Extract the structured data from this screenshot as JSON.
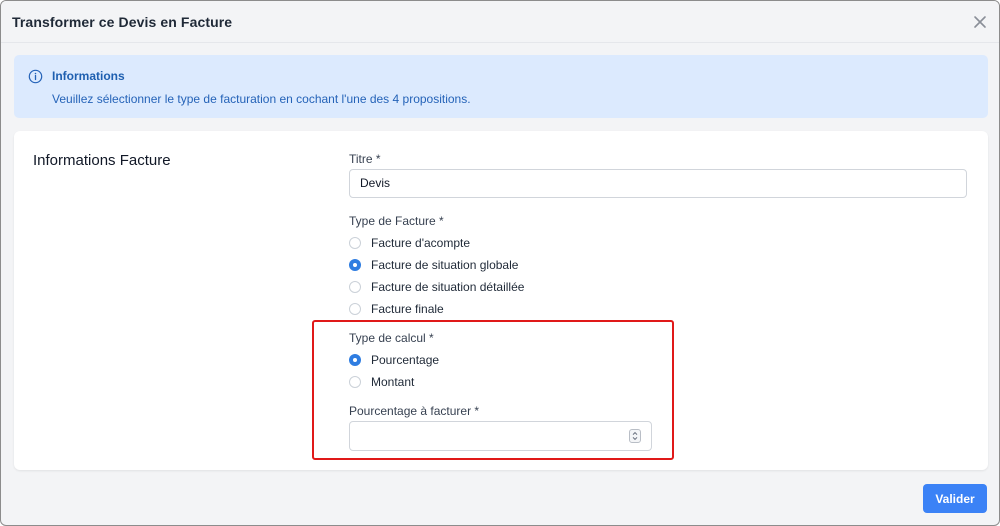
{
  "modal": {
    "title": "Transformer ce Devis en Facture",
    "close_icon": "close-icon"
  },
  "alert": {
    "icon": "info-icon",
    "title": "Informations",
    "text": "Veuillez sélectionner le type de facturation en cochant l'une des 4 propositions."
  },
  "form": {
    "section_title": "Informations Facture",
    "titre": {
      "label": "Titre *",
      "value": "Devis"
    },
    "type_facture": {
      "label": "Type de Facture *",
      "options": [
        {
          "label": "Facture d'acompte",
          "checked": false
        },
        {
          "label": "Facture de situation globale",
          "checked": true
        },
        {
          "label": "Facture de situation détaillée",
          "checked": false
        },
        {
          "label": "Facture finale",
          "checked": false
        }
      ]
    },
    "type_calcul": {
      "label": "Type de calcul *",
      "options": [
        {
          "label": "Pourcentage",
          "checked": true
        },
        {
          "label": "Montant",
          "checked": false
        }
      ]
    },
    "pourcentage": {
      "label": "Pourcentage à facturer *",
      "value": ""
    }
  },
  "footer": {
    "submit_label": "Valider"
  },
  "colors": {
    "accent": "#3b82f6",
    "alert_bg": "#dceafe",
    "highlight": "#e01919"
  }
}
